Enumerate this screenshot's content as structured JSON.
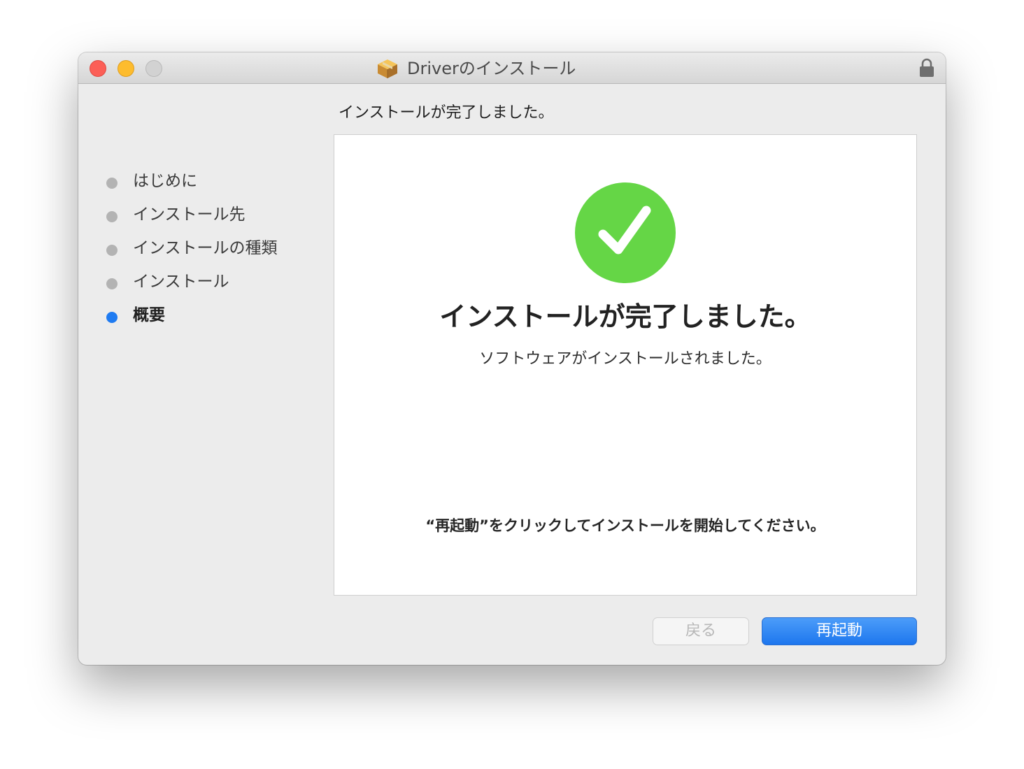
{
  "window": {
    "title": "Driverのインストール",
    "icons": {
      "app": "package-icon",
      "lock": "lock-icon"
    }
  },
  "sidebar": {
    "items": [
      {
        "label": "はじめに",
        "state": "done"
      },
      {
        "label": "インストール先",
        "state": "done"
      },
      {
        "label": "インストールの種類",
        "state": "done"
      },
      {
        "label": "インストール",
        "state": "done"
      },
      {
        "label": "概要",
        "state": "active"
      }
    ]
  },
  "main": {
    "heading": "インストールが完了しました。",
    "status_icon": "checkmark-circle-icon",
    "title": "インストールが完了しました。",
    "subtitle": "ソフトウェアがインストールされました。",
    "instruction": "“再起動”をクリックしてインストールを開始してください。"
  },
  "buttons": {
    "back_label": "戻る",
    "restart_label": "再起動"
  },
  "colors": {
    "accent": "#1f7bf1",
    "success": "#65d646",
    "close": "#fc5f57",
    "minimize": "#fdbc2e"
  }
}
